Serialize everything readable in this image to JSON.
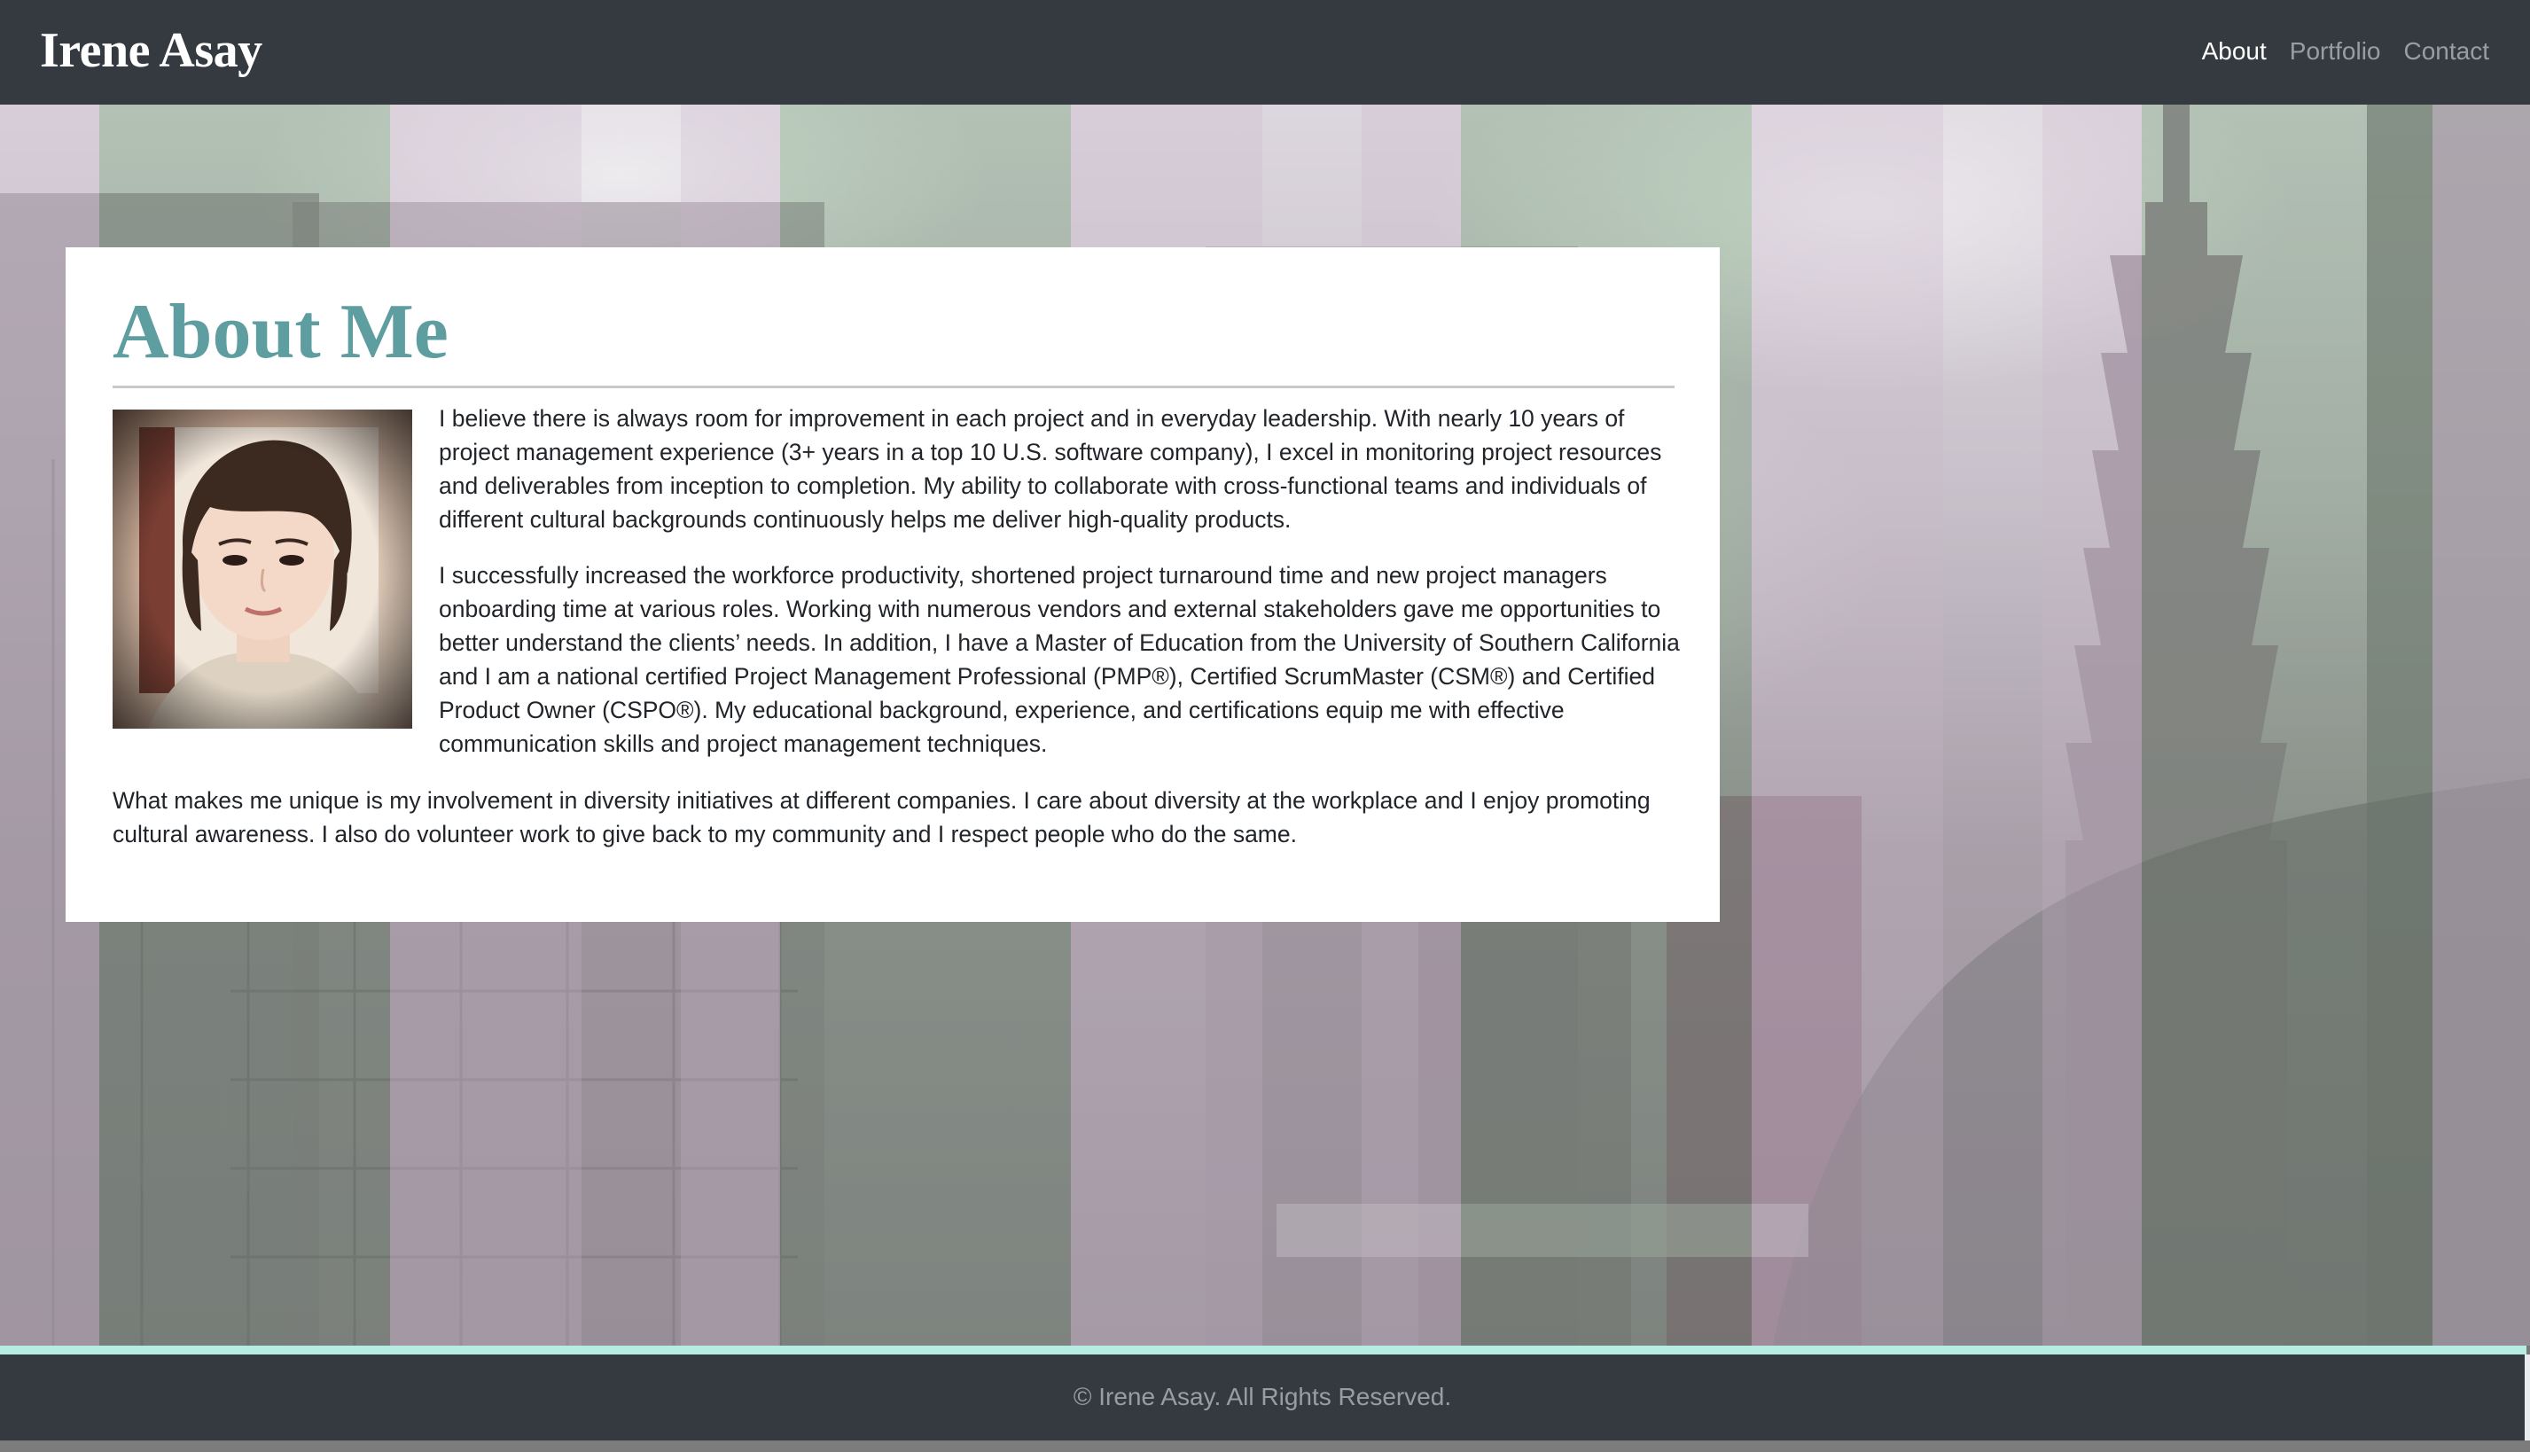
{
  "header": {
    "brand": "Irene Asay",
    "nav": [
      {
        "label": "About",
        "active": true
      },
      {
        "label": "Portfolio",
        "active": false
      },
      {
        "label": "Contact",
        "active": false
      }
    ]
  },
  "about": {
    "title": "About Me",
    "paragraphs": [
      "I believe there is always room for improvement in each project and in everyday leadership. With nearly 10 years of project management experience (3+ years in a top 10 U.S. software company), I excel in monitoring project resources and deliverables from inception to completion. My ability to collaborate with cross-functional teams and individuals of different cultural backgrounds continuously helps me deliver high-quality products.",
      "I successfully increased the workforce productivity, shortened project turnaround time and new project managers onboarding time at various roles. Working with numerous vendors and external stakeholders gave me opportunities to better understand the clients’ needs. In addition, I have a Master of Education from the University of Southern California and I am a national certified Project Management Professional (PMP®), Certified ScrumMaster (CSM®) and Certified Product Owner (CSPO®). My educational background, experience, and certifications equip me with effective communication skills and project management techniques.",
      "What makes me unique is my involvement in diversity initiatives at different companies. I care about diversity at the workplace and I enjoy promoting cultural awareness. I also do volunteer work to give back to my community and I respect people who do the same."
    ]
  },
  "footer": {
    "text": "© Irene Asay. All Rights Reserved."
  },
  "colors": {
    "navbar": "#343a40",
    "heading": "#5f9ea0",
    "accent_line": "#b7ece5"
  }
}
